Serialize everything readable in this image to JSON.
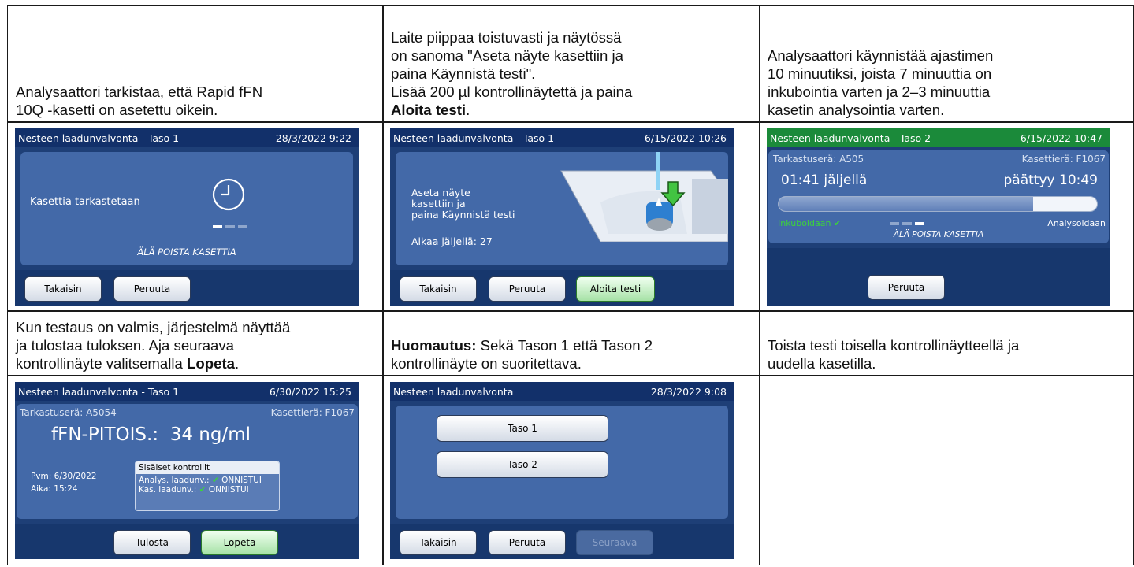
{
  "rows": [
    {
      "cells": [
        {
          "lines": [
            "Analysaattori tarkistaa, että Rapid fFN",
            "10Q -kasetti on asetettu oikein."
          ]
        },
        {
          "lines": [
            "Laite piippaa toistuvasti ja näytössä",
            "on sanoma \"Aseta näyte kasettiin ja",
            "paina Käynnistä testi\".",
            "Lisää 200 µl kontrollinäytettä ja paina"
          ],
          "bold": "Aloita testi",
          "after": "."
        },
        {
          "lines": [
            "Analysaattori käynnistää ajastimen",
            "10 minuutiksi, joista 7 minuuttia on",
            "inkubointia varten ja 2–3 minuuttia",
            "kasetin analysointia varten."
          ]
        }
      ]
    },
    {
      "cells": [
        {
          "lines": [
            "Kun testaus on valmis, järjestelmä näyttää",
            "ja tulostaa tuloksen. Aja seuraava"
          ],
          "last_prefix": "kontrollinäyte valitsemalla ",
          "bold": "Lopeta",
          "after": "."
        },
        {
          "bold_first": "Huomautus:",
          "first_rest": " Sekä Tason 1 että Tason 2",
          "lines": [
            "kontrollinäyte on suoritettava."
          ]
        },
        {
          "lines": [
            "Toista testi toisella kontrollinäytteellä ja",
            "uudella kasetilla."
          ]
        }
      ]
    }
  ],
  "screens": {
    "s1": {
      "title": "Nesteen laadunvalvonta - Taso 1",
      "date": "28/3/2022 9:22",
      "message": "Kasettia tarkastetaan",
      "warning": "ÄLÄ POISTA KASETTIA",
      "btn1": "Takaisin",
      "btn2": "Peruuta",
      "icon": "clock-icon"
    },
    "s2": {
      "title": "Nesteen laadunvalvonta - Taso 1",
      "date": "6/15/2022 10:26",
      "msg1": "Aseta näyte",
      "msg2": "kasettiin ja",
      "msg3": "paina Käynnistä testi",
      "time_left": "Aikaa jäljellä: 27",
      "btn1": "Takaisin",
      "btn2": "Peruuta",
      "btn3": "Aloita testi",
      "icon": "cassette-pipette-icon"
    },
    "s3": {
      "title": "Nesteen laadunvalvonta - Taso 2",
      "date": "6/15/2022 10:47",
      "lot_label": "Tarkastuserä: A505",
      "cassette_label": "Kasettierä: F1067",
      "remaining": "01:41 jäljellä",
      "ends": "päättyy 10:49",
      "progress": 0.8,
      "incubating": "Inkuboidaan",
      "analysing": "Analysoidaan",
      "warning": "ÄLÄ POISTA KASETTIA",
      "btn": "Peruuta"
    },
    "s4": {
      "title": "Nesteen laadunvalvonta - Taso 1",
      "date": "6/30/2022 15:25",
      "lot_label": "Tarkastuserä: A5054",
      "cassette_label": "Kasettierä: F1067",
      "result": "fFN-PITOIS.:  34 ng/ml",
      "pvm": "Pvm: 6/30/2022",
      "aika": "Aika: 15:24",
      "ic_title": "Sisäiset kontrollit",
      "ic1_label": "Analys. laadunv.:",
      "ic1_val": "ONNISTUI",
      "ic2_label": "Kas. laadunv.:",
      "ic2_val": "ONNISTUI",
      "btn1": "Tulosta",
      "btn2": "Lopeta"
    },
    "s5": {
      "title": "Nesteen laadunvalvonta",
      "date": "28/3/2022 9:08",
      "level1": "Taso 1",
      "level2": "Taso 2",
      "btn1": "Takaisin",
      "btn2": "Peruuta",
      "btn3": "Seuraava"
    }
  },
  "colors": {
    "screen_bg": "#1e3f77",
    "status_bar": "#12306a",
    "status_bar_active": "#1b8a3a",
    "panel": "#4369a8",
    "check": "#3cd23c"
  }
}
